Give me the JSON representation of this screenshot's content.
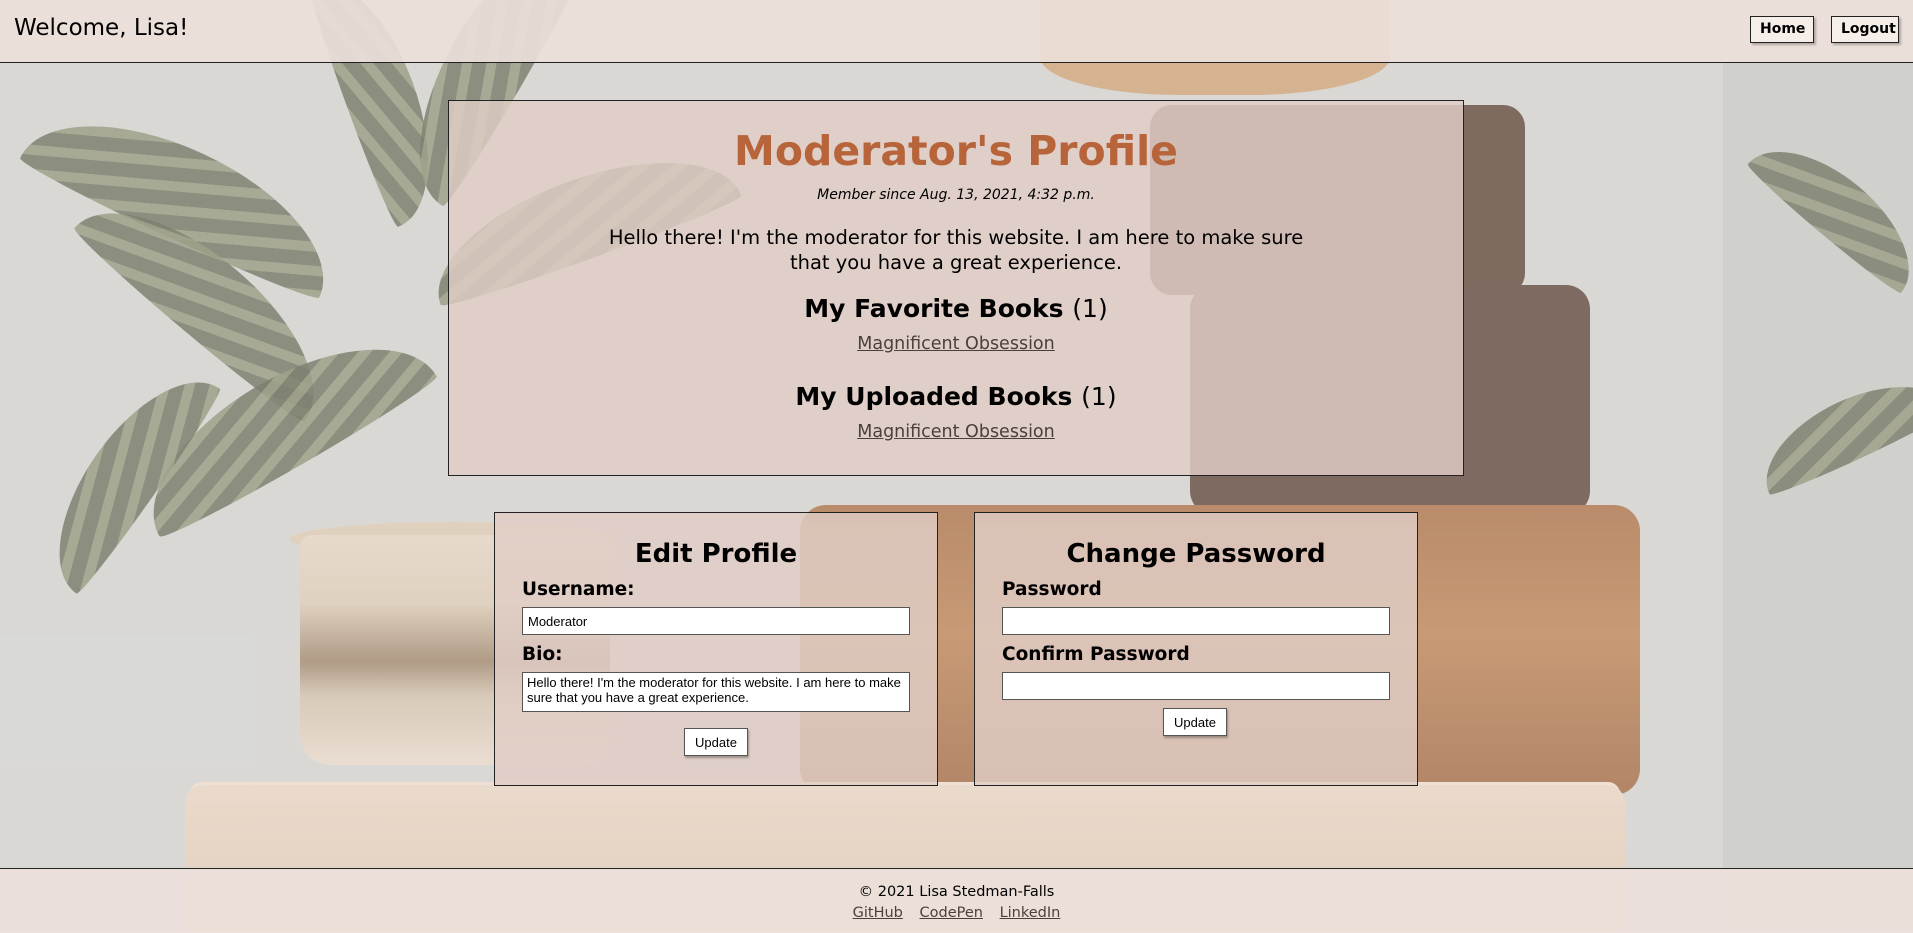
{
  "header": {
    "welcome": "Welcome, Lisa!",
    "home_label": "Home",
    "logout_label": "Logout"
  },
  "profile": {
    "title": "Moderator's Profile",
    "member_since": "Member since Aug. 13, 2021, 4:32 p.m.",
    "bio": "Hello there! I'm the moderator for this website. I am here to make sure that you have a great experience.",
    "favorites": {
      "heading": "My Favorite Books",
      "count": "(1)",
      "items": [
        "Magnificent Obsession"
      ]
    },
    "uploads": {
      "heading": "My Uploaded Books",
      "count": "(1)",
      "items": [
        "Magnificent Obsession"
      ]
    }
  },
  "edit_profile": {
    "title": "Edit Profile",
    "username_label": "Username:",
    "username_value": "Moderator",
    "bio_label": "Bio:",
    "bio_value": "Hello there! I'm the moderator for this website. I am here to make sure that you have a great experience.",
    "update_label": "Update"
  },
  "change_password": {
    "title": "Change Password",
    "password_label": "Password",
    "password_value": "",
    "confirm_label": "Confirm Password",
    "confirm_value": "",
    "update_label": "Update"
  },
  "footer": {
    "copyright": "© 2021 Lisa Stedman-Falls",
    "links": [
      "GitHub",
      "CodePen",
      "LinkedIn"
    ]
  },
  "colors": {
    "title_accent": "#b7643a",
    "panel_bg": "#e1cdc6",
    "link": "#4a3f3a"
  }
}
